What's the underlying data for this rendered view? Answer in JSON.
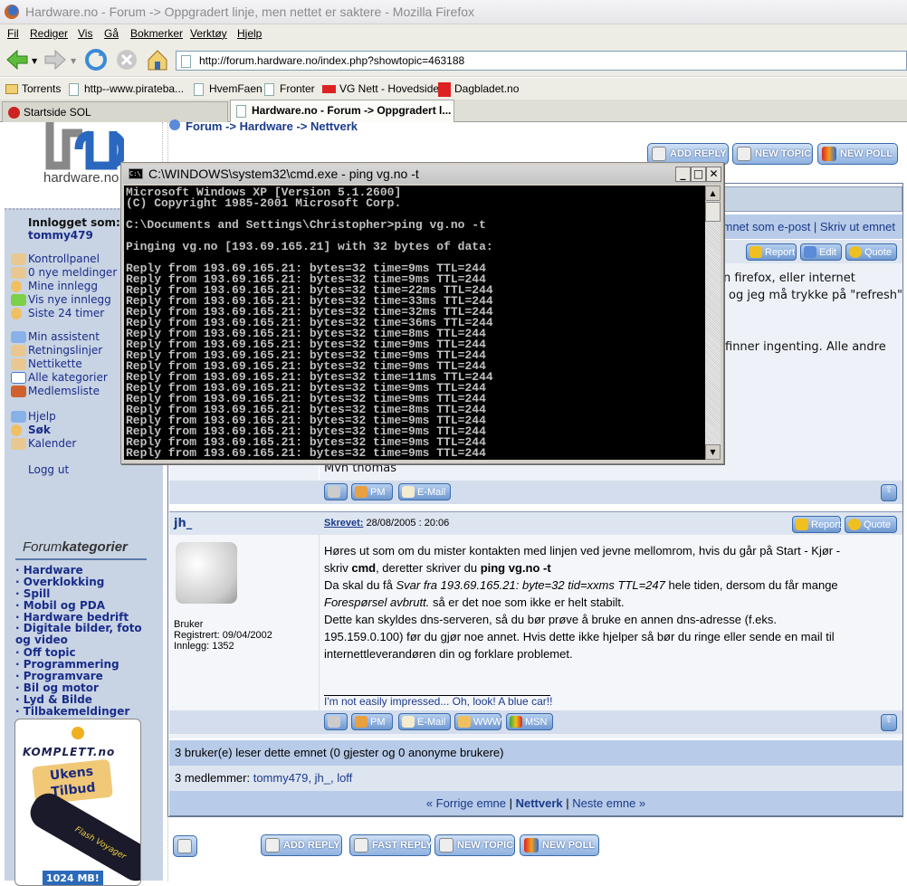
{
  "window": {
    "title": "Hardware.no - Forum -> Oppgradert linje, men nettet er saktere - Mozilla Firefox"
  },
  "menu": [
    "Fil",
    "Rediger",
    "Vis",
    "Gå",
    "Bokmerker",
    "Verktøy",
    "Hjelp"
  ],
  "address": {
    "url": "http://forum.hardware.no/index.php?showtopic=463188"
  },
  "bookmarks": [
    "Torrents",
    "http--www.pirateba...",
    "HvemFaen",
    "Fronter",
    "VG Nett - Hovedsiden",
    "Dagbladet.no"
  ],
  "tabs": [
    {
      "label": "Startside SOL",
      "active": false
    },
    {
      "label": "Hardware.no - Forum -> Oppgradert l...",
      "active": true
    }
  ],
  "logo": {
    "text": "hardware.no"
  },
  "breadcrumb": "Forum -> Hardware -> Nettverk",
  "sidebar": {
    "logged_in_label": "Innlogget som:",
    "username": "tommy479",
    "links1": [
      "Kontrollpanel",
      "0 nye meldinger",
      "Mine innlegg",
      "Vis nye innlegg",
      "Siste 24 timer"
    ],
    "links2": [
      "Min assistent",
      "Retningslinjer",
      "Nettikette",
      "Alle kategorier",
      "Medlemsliste"
    ],
    "links3": [
      "Hjelp",
      "Søk",
      "Kalender"
    ],
    "logout": "Logg ut",
    "categories_title_a": "Forum",
    "categories_title_b": "kategorier",
    "categories": [
      "Hardware",
      "Overklokking",
      "Spill",
      "Mobil og PDA",
      "Hardware bedrift",
      "Digitale bilder, foto og video",
      "Off topic",
      "Programmering",
      "Programvare",
      "Bil og motor",
      "Lyd & Bilde",
      "Tilbakemeldinger"
    ],
    "ad": {
      "brand": "KOMPLETT.no",
      "tag": "Ukens Tilbud",
      "product": "Flash Voyager",
      "size": "1024 MB!"
    }
  },
  "top_buttons": {
    "add_reply": "ADD REPLY",
    "new_topic": "NEW TOPIC",
    "new_poll": "NEW POLL"
  },
  "topic_options": "mnet som e-post | Skriv ut emnet",
  "post1": {
    "buttons": {
      "report": "Report",
      "edit": "Edit",
      "quote": "Quote"
    },
    "lines": [
      "n firefox, eller internet",
      "og jeg må trykke på \"refresh\"",
      "finner ingenting. Alle andre"
    ],
    "signoff": "Mvh thomas",
    "actions": {
      "pm": "PM",
      "email": "E-Mail"
    }
  },
  "post2": {
    "author": "jh_",
    "written_label": "Skrevet:",
    "date": "28/08/2005 : 20:06",
    "buttons": {
      "report": "Report",
      "quote": "Quote"
    },
    "group": "Bruker",
    "registered": "Registrert: 09/04/2002",
    "posts": "Innlegg: 1352",
    "body": {
      "l1": "Høres ut som om du mister kontakten med linjen ved jevne mellomrom, hvis du går på Start - Kjør -",
      "l2a": "skriv ",
      "l2b": "cmd",
      "l2c": ", deretter skriver du ",
      "l2d": "ping vg.no -t",
      "l3a": "Da skal du få ",
      "l3b": "Svar fra 193.69.165.21: byte=32 tid=xxms TTL=247",
      "l3c": " hele tiden, dersom du får mange",
      "l4a": "Forespørsel avbrutt.",
      "l4b": " så er det noe som ikke er helt stabilt.",
      "l5": "Dette kan skyldes dns-serveren, så du bør prøve å bruke en annen dns-adresse (f.eks.",
      "l6": "195.159.0.100) før du gjør noe annet. Hvis dette ikke hjelper så bør du ringe eller sende en mail til",
      "l7": "internettleverandøren din og forklare problemet."
    },
    "signature": "I'm not easily impressed... Oh, look! A blue car!!",
    "actions": {
      "pm": "PM",
      "email": "E-Mail",
      "www": "WWW",
      "msn": "MSN"
    }
  },
  "readers": "3 bruker(e) leser dette emnet (0 gjester og 0 anonyme brukere)",
  "members": {
    "label": "3 medlemmer: ",
    "names": "tommy479, jh_, loff"
  },
  "topic_nav": {
    "prev": "« Forrige emne",
    "sep": " | ",
    "forum": "Nettverk",
    "next": "Neste emne »"
  },
  "bottom_buttons": {
    "add_reply": "ADD REPLY",
    "fast_reply": "FAST REPLY",
    "new_topic": "NEW TOPIC",
    "new_poll": "NEW POLL"
  },
  "cmd": {
    "title": "C:\\WINDOWS\\system32\\cmd.exe - ping vg.no -t",
    "lines": [
      "Microsoft Windows XP [Version 5.1.2600]",
      "(C) Copyright 1985-2001 Microsoft Corp.",
      "",
      "C:\\Documents and Settings\\Christopher>ping vg.no -t",
      "",
      "Pinging vg.no [193.69.165.21] with 32 bytes of data:",
      "",
      "Reply from 193.69.165.21: bytes=32 time=9ms TTL=244",
      "Reply from 193.69.165.21: bytes=32 time=9ms TTL=244",
      "Reply from 193.69.165.21: bytes=32 time=22ms TTL=244",
      "Reply from 193.69.165.21: bytes=32 time=33ms TTL=244",
      "Reply from 193.69.165.21: bytes=32 time=32ms TTL=244",
      "Reply from 193.69.165.21: bytes=32 time=36ms TTL=244",
      "Reply from 193.69.165.21: bytes=32 time=8ms TTL=244",
      "Reply from 193.69.165.21: bytes=32 time=9ms TTL=244",
      "Reply from 193.69.165.21: bytes=32 time=9ms TTL=244",
      "Reply from 193.69.165.21: bytes=32 time=9ms TTL=244",
      "Reply from 193.69.165.21: bytes=32 time=11ms TTL=244",
      "Reply from 193.69.165.21: bytes=32 time=9ms TTL=244",
      "Reply from 193.69.165.21: bytes=32 time=9ms TTL=244",
      "Reply from 193.69.165.21: bytes=32 time=8ms TTL=244",
      "Reply from 193.69.165.21: bytes=32 time=9ms TTL=244",
      "Reply from 193.69.165.21: bytes=32 time=9ms TTL=244",
      "Reply from 193.69.165.21: bytes=32 time=9ms TTL=244",
      "Reply from 193.69.165.21: bytes=32 time=9ms TTL=244"
    ]
  }
}
